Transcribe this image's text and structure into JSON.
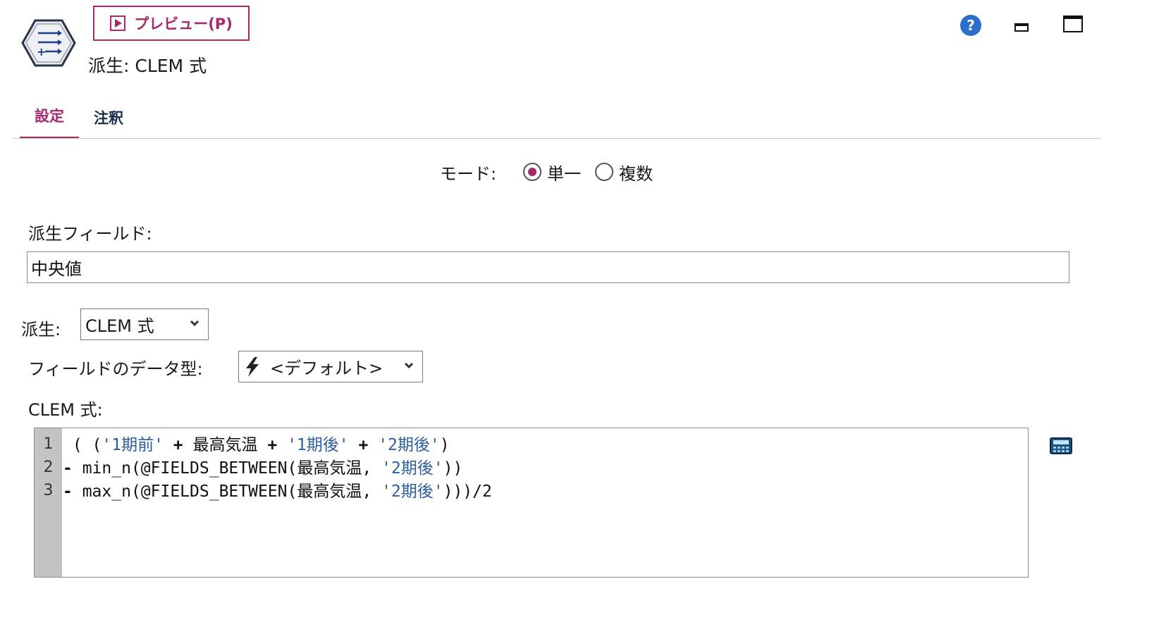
{
  "header": {
    "node_icon": "derive-node-icon",
    "preview_label": "プレビュー(P)",
    "node_title": "派生: CLEM 式",
    "icons": [
      "help-icon",
      "minimize-icon",
      "maximize-icon"
    ]
  },
  "tabs": [
    {
      "label": "設定",
      "active": true
    },
    {
      "label": "注釈",
      "active": false
    }
  ],
  "mode": {
    "label": "モード:",
    "options": [
      {
        "label": "単一",
        "selected": true
      },
      {
        "label": "複数",
        "selected": false
      }
    ]
  },
  "derive_field": {
    "label": "派生フィールド:",
    "value": "中央値"
  },
  "derive_as": {
    "label": "派生:",
    "value": "CLEM 式"
  },
  "field_type": {
    "label": "フィールドのデータ型:",
    "value": "<デフォルト>"
  },
  "clem": {
    "label": "CLEM 式:",
    "line_numbers": [
      "1",
      "2",
      "3"
    ],
    "lines": [
      " ( ('1期前' + 最高気温 + '1期後' + '2期後')",
      "- min_n(@FIELDS_BETWEEN(最高気温, '2期後'))",
      "- max_n(@FIELDS_BETWEEN(最高気温, '2期後')))/2"
    ]
  },
  "colors": {
    "accent": "#a52a6c",
    "help_blue": "#2a6fc9",
    "string_blue": "#2d5f9e",
    "gutter": "#c4c4c4"
  }
}
